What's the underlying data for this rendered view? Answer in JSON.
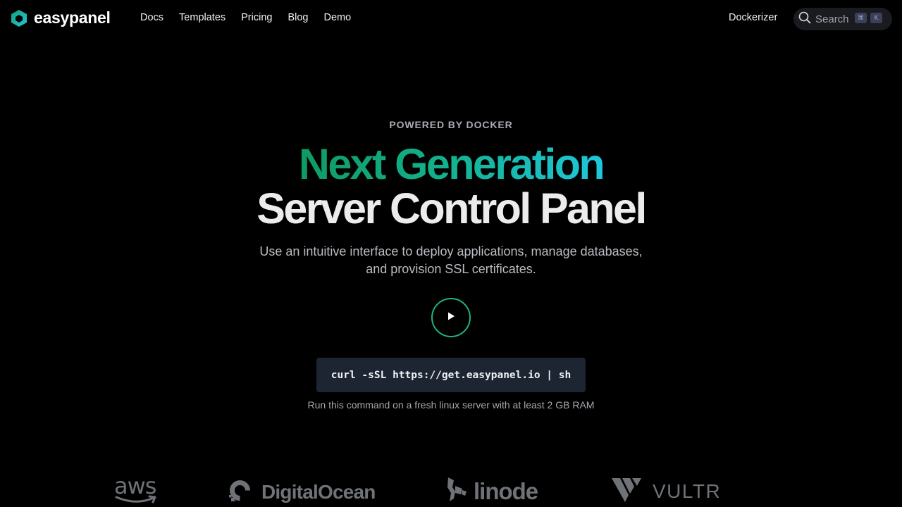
{
  "brand": {
    "name": "easypanel",
    "icon": "hexagon-logo-icon"
  },
  "nav": {
    "links": [
      "Docs",
      "Templates",
      "Pricing",
      "Blog",
      "Demo"
    ],
    "dockerizer": "Dockerizer",
    "search": {
      "label": "Search",
      "shortcut_mod": "⌘",
      "shortcut_key": "K"
    }
  },
  "hero": {
    "kicker": "POWERED BY DOCKER",
    "title_line1": "Next Generation",
    "title_line2": "Server Control Panel",
    "subtitle_line1": "Use an intuitive interface to deploy applications, manage databases,",
    "subtitle_line2": "and provision SSL certificates.",
    "play_icon": "play-icon",
    "command": "curl -sSL https://get.easypanel.io | sh",
    "hint": "Run this command on a fresh linux server with at least 2 GB RAM"
  },
  "providers": {
    "aws": "aws",
    "digitalocean": "DigitalOcean",
    "linode": "linode",
    "vultr": "VULTR"
  },
  "colors": {
    "background": "#000000",
    "accent_green": "#0f9a63",
    "accent_cyan": "#1fc7dc",
    "play_ring": "#1db483",
    "command_bg": "#1e2532"
  }
}
